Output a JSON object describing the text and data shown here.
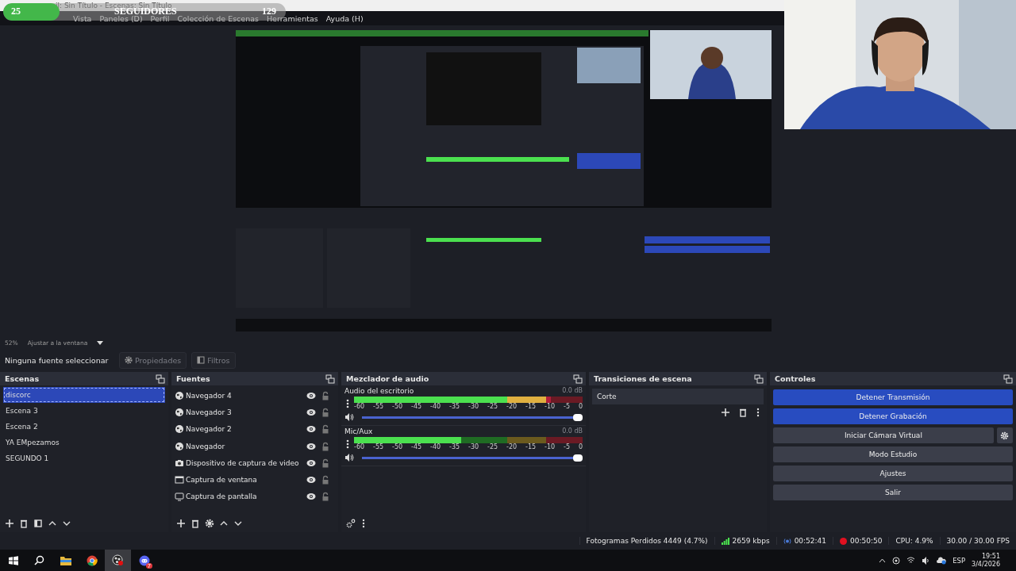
{
  "window": {
    "title": "il: Sin Título - Escenas: Sin Título"
  },
  "menu": [
    "Vista",
    "Paneles (D)",
    "Perfil",
    "Colección de Escenas",
    "Herramientas",
    "Ayuda (H)"
  ],
  "follower_goal": {
    "current": "25",
    "label": "SEGUIDORES",
    "target": "129",
    "level": 0.2
  },
  "zoom": {
    "percent": "52%",
    "mode": "Ajustar a la ventana"
  },
  "source_toolbar": {
    "status": "Ninguna fuente seleccionar",
    "buttons": [
      {
        "label": "Propiedades",
        "kind": "gear",
        "disabled": true
      },
      {
        "label": "Filtros",
        "kind": "filter",
        "disabled": true
      }
    ]
  },
  "scenes": {
    "title": "Escenas",
    "items": [
      {
        "name": "discorc",
        "selected": true
      },
      {
        "name": "Escena 3",
        "selected": false
      },
      {
        "name": "Escena 2",
        "selected": false
      },
      {
        "name": "YA EMpezamos",
        "selected": false
      },
      {
        "name": "SEGUNDO 1",
        "selected": false
      }
    ]
  },
  "sources": {
    "title": "Fuentes",
    "items": [
      {
        "name": "Navegador 4",
        "kind": "browser",
        "visible": true
      },
      {
        "name": "Navegador 3",
        "kind": "browser",
        "visible": true
      },
      {
        "name": "Navegador 2",
        "kind": "browser",
        "visible": true
      },
      {
        "name": "Navegador",
        "kind": "browser",
        "visible": true
      },
      {
        "name": "Dispositivo de captura de video",
        "kind": "camera",
        "visible": true
      },
      {
        "name": "Captura de ventana",
        "kind": "window",
        "visible": true
      },
      {
        "name": "Captura de pantalla",
        "kind": "display",
        "visible": true
      }
    ]
  },
  "mixer": {
    "title": "Mezclador de audio",
    "channels": [
      {
        "name": "Audio del escritorio",
        "reading": "0.0 dB",
        "level": 0.86,
        "volume": {
          "level": 1
        },
        "ticks": [
          "-60",
          "-55",
          "-50",
          "-45",
          "-40",
          "-35",
          "-30",
          "-25",
          "-20",
          "-15",
          "-10",
          "-5",
          "0"
        ]
      },
      {
        "name": "Mic/Aux",
        "reading": "0.0 dB",
        "level": 0.47,
        "volume": {
          "level": 1
        },
        "ticks": [
          "-60",
          "-55",
          "-50",
          "-45",
          "-40",
          "-35",
          "-30",
          "-25",
          "-20",
          "-15",
          "-10",
          "-5",
          "0"
        ]
      }
    ]
  },
  "transitions": {
    "title": "Transiciones de escena",
    "selected": "Corte"
  },
  "controls": {
    "title": "Controles",
    "buttons": [
      {
        "label": "Detener Transmisión",
        "active": true
      },
      {
        "label": "Detener Grabación",
        "active": true
      },
      {
        "label": "Iniciar Cámara Virtual",
        "active": false,
        "settings": true
      },
      {
        "label": "Modo Estudio",
        "active": false
      },
      {
        "label": "Ajustes",
        "active": false
      },
      {
        "label": "Salir",
        "active": false
      }
    ]
  },
  "status_bar": {
    "dropped_frames": "Fotogramas Perdidos 4449 (4.7%)",
    "bitrate": "2659 kbps",
    "stream_time": "00:52:41",
    "record_time": "00:50:50",
    "cpu": "CPU: 4.9%",
    "fps": "30.00 / 30.00 FPS"
  },
  "taskbar": {
    "apps": [
      {
        "kind": "start",
        "selected": false
      },
      {
        "kind": "search",
        "selected": false
      },
      {
        "kind": "folder",
        "selected": false
      },
      {
        "kind": "chrome",
        "selected": false
      },
      {
        "kind": "obs",
        "selected": true
      },
      {
        "kind": "discord",
        "selected": false,
        "badge": "7"
      }
    ],
    "language": "ESP",
    "time": "19:51",
    "date": "3/4/2026"
  }
}
